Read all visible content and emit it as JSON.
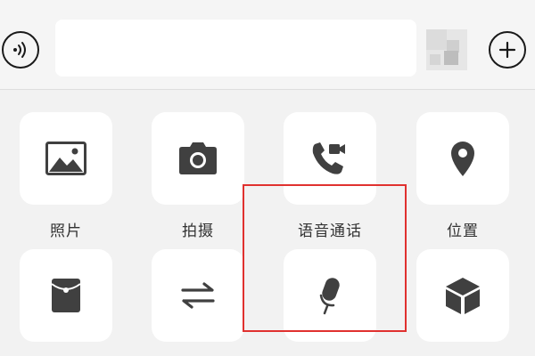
{
  "input_bar": {
    "voice_icon": "voice-wave-icon",
    "message_value": "",
    "emoji_icon": "emoji-icon",
    "more_icon": "plus-icon"
  },
  "panel": {
    "items": [
      {
        "label": "照片",
        "icon": "photo-icon"
      },
      {
        "label": "拍摄",
        "icon": "camera-icon"
      },
      {
        "label": "语音通话",
        "icon": "call-video-icon"
      },
      {
        "label": "位置",
        "icon": "location-icon"
      },
      {
        "label": "",
        "icon": "red-packet-icon"
      },
      {
        "label": "",
        "icon": "transfer-icon"
      },
      {
        "label": "",
        "icon": "microphone-icon"
      },
      {
        "label": "",
        "icon": "box-icon"
      }
    ],
    "selected_index": 2
  },
  "colors": {
    "icon": "#404040",
    "highlight": "#e0312f",
    "tile": "#ffffff",
    "background": "#f2f2f2"
  }
}
